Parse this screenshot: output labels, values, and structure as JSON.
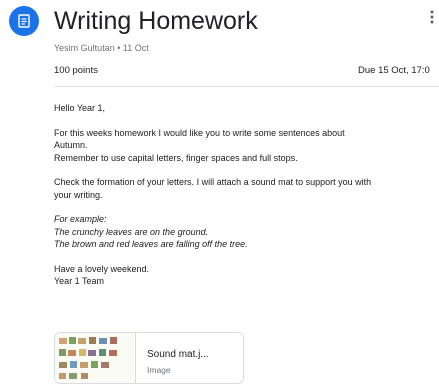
{
  "header": {
    "title": "Writing Homework",
    "author_date": "Yesim Gultutan • 11 Oct",
    "points": "100 points",
    "due": "Due 15 Oct, 17:0"
  },
  "body": {
    "greeting": "Hello Year 1,",
    "para1_line1": "For this weeks homework I would like you to write some sentences about",
    "para1_line2": "Autumn.",
    "para1_line3": "Remember to use capital letters, finger spaces and full stops.",
    "para2_line1": "Check the formation of your letters. I will attach a sound mat to support you with",
    "para2_line2": "your writing.",
    "example_heading": "For example:",
    "example_1": "The crunchy leaves are on the ground.",
    "example_2": "The brown and red leaves are falling off the tree.",
    "closing_1": "Have a lovely weekend.",
    "closing_2": "Year 1 Team"
  },
  "attachment": {
    "name": "Sound mat.j...",
    "type": "Image"
  },
  "icons": {
    "assignment": "assignment-icon",
    "more": "more-vert-icon"
  },
  "colors": {
    "accent": "#1a73e8"
  }
}
